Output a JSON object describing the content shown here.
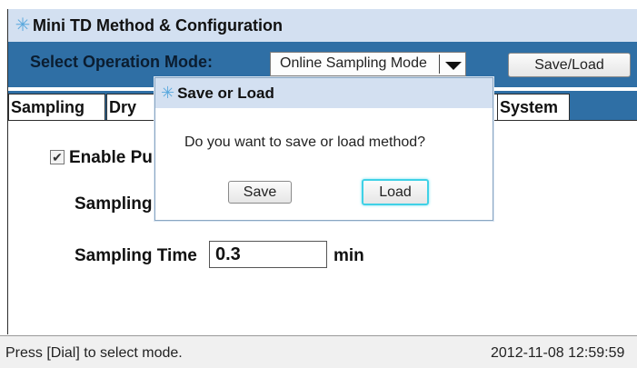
{
  "app": {
    "title": "Mini TD Method & Configuration",
    "icon": "asterisk-icon"
  },
  "operation": {
    "label": "Select Operation Mode:",
    "mode_value": "Online Sampling Mode",
    "saveload_label": "Save/Load"
  },
  "tabs": [
    "Sampling",
    "Dry",
    "",
    "System"
  ],
  "content": {
    "enable_label": "Enable Pu",
    "enable_checked": true,
    "sampling_label": "Sampling",
    "sampling_time_label": "Sampling Time",
    "sampling_time_value": "0.3",
    "sampling_time_unit": "min"
  },
  "dialog": {
    "title": "Save or Load",
    "message": "Do you want to save or load method?",
    "save_label": "Save",
    "load_label": "Load"
  },
  "status": {
    "message": "Press [Dial] to select mode.",
    "timestamp": "2012-11-08 12:59:59"
  },
  "colors": {
    "accent": "#2f6fa5",
    "title_bg": "#d3e0f1",
    "focus": "#3fd1e6"
  }
}
